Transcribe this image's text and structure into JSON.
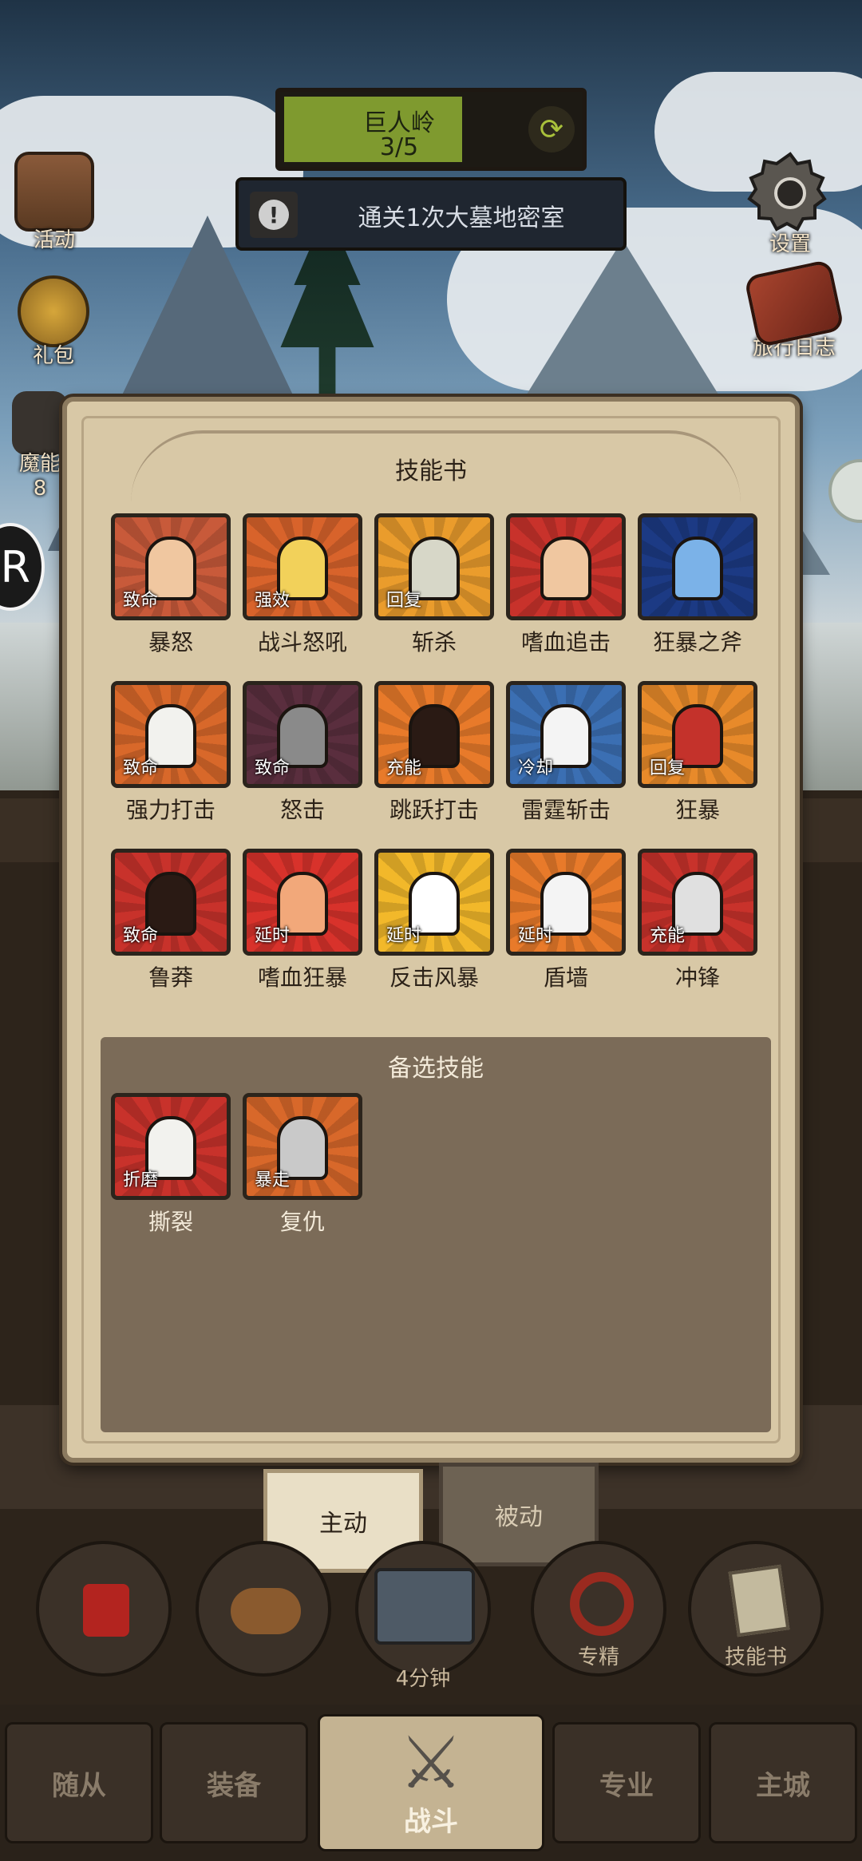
{
  "hud": {
    "region_name": "巨人岭",
    "region_progress": "3/5",
    "progress_fraction": 0.6,
    "quest_text": "通关1次大墓地密室"
  },
  "side_left": [
    {
      "label": "活动",
      "icon": "event-board-icon"
    },
    {
      "label": "礼包",
      "icon": "gift-coin-icon"
    },
    {
      "label": "魔能",
      "icon": "magic-icon"
    }
  ],
  "side_right": [
    {
      "label": "设置",
      "icon": "gear-icon"
    },
    {
      "label": "旅行日志",
      "icon": "journal-book-icon"
    }
  ],
  "side_left_count": "8",
  "dialog": {
    "title": "技能书",
    "skills": [
      {
        "name": "暴怒",
        "tag": "致命",
        "colors": [
          "#c85a3a",
          "#f0c7a0"
        ]
      },
      {
        "name": "战斗怒吼",
        "tag": "强效",
        "colors": [
          "#d8632b",
          "#f2d15a"
        ]
      },
      {
        "name": "斩杀",
        "tag": "回复",
        "colors": [
          "#ea9c2c",
          "#d7d7c8"
        ]
      },
      {
        "name": "嗜血追击",
        "tag": "",
        "colors": [
          "#c8322b",
          "#f0c7a0"
        ]
      },
      {
        "name": "狂暴之斧",
        "tag": "",
        "colors": [
          "#1c3a84",
          "#7bb2e8"
        ]
      },
      {
        "name": "强力打击",
        "tag": "致命",
        "colors": [
          "#d8682a",
          "#f2f2ee"
        ]
      },
      {
        "name": "怒击",
        "tag": "致命",
        "colors": [
          "#5a2e3e",
          "#8a8a8a"
        ]
      },
      {
        "name": "跳跃打击",
        "tag": "充能",
        "colors": [
          "#e87a2a",
          "#2a1a14"
        ]
      },
      {
        "name": "雷霆斩击",
        "tag": "冷却",
        "colors": [
          "#3b6fb3",
          "#f4f4f4"
        ]
      },
      {
        "name": "狂暴",
        "tag": "回复",
        "colors": [
          "#e88a2a",
          "#c4322b"
        ]
      },
      {
        "name": "鲁莽",
        "tag": "致命",
        "colors": [
          "#c8322b",
          "#2a1a14"
        ]
      },
      {
        "name": "嗜血狂暴",
        "tag": "延时",
        "colors": [
          "#d8322b",
          "#f2a87a"
        ]
      },
      {
        "name": "反击风暴",
        "tag": "延时",
        "colors": [
          "#f2b82a",
          "#ffffff"
        ]
      },
      {
        "name": "盾墙",
        "tag": "延时",
        "colors": [
          "#e87a2a",
          "#f4f4f4"
        ]
      },
      {
        "name": "冲锋",
        "tag": "充能",
        "colors": [
          "#c8322b",
          "#e0e0e0"
        ]
      }
    ],
    "reserve_title": "备选技能",
    "reserve_skills": [
      {
        "name": "撕裂",
        "tag": "折磨",
        "colors": [
          "#c8322b",
          "#f2f2ee"
        ]
      },
      {
        "name": "复仇",
        "tag": "暴走",
        "colors": [
          "#d8682a",
          "#c9c9c9"
        ]
      }
    ]
  },
  "sub_tabs": {
    "active": "主动",
    "passive": "被动"
  },
  "actions": {
    "chest_timer": "4分钟",
    "specialize": "专精",
    "skillbook": "技能书"
  },
  "nav": {
    "followers": "随从",
    "equipment": "装备",
    "battle": "战斗",
    "profession": "专业",
    "main_city": "主城"
  }
}
